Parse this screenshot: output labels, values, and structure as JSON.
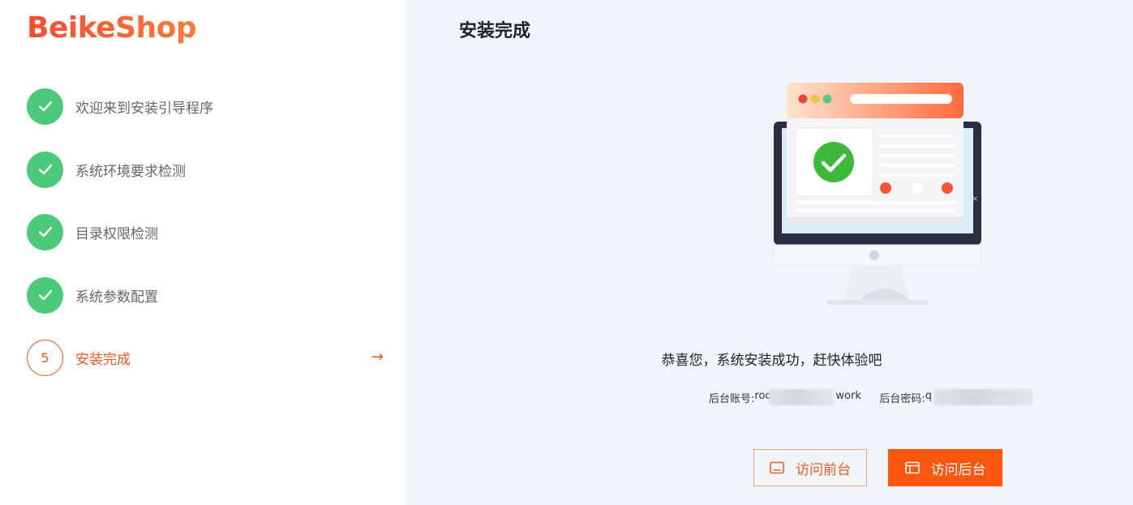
{
  "brand": {
    "logo_text": "BeikeShop",
    "accent_color": "#f05a22",
    "success_color": "#4cc97a"
  },
  "sidebar": {
    "steps": [
      {
        "label": "欢迎来到安装引导程序",
        "status": "done",
        "icon": "check-icon"
      },
      {
        "label": "系统环境要求检测",
        "status": "done",
        "icon": "check-icon"
      },
      {
        "label": "目录权限检测",
        "status": "done",
        "icon": "check-icon"
      },
      {
        "label": "系统参数配置",
        "status": "done",
        "icon": "check-icon"
      },
      {
        "label": "安装完成",
        "status": "current",
        "number": "5",
        "arrow": "→"
      }
    ]
  },
  "main": {
    "title": "安装完成",
    "success_message": "恭喜您，系统安装成功，赶快体验吧",
    "credentials": {
      "account_label": "后台账号: ",
      "account_prefix": "root",
      "account_suffix": "work",
      "password_label": "后台密码: ",
      "password_prefix": "q"
    },
    "buttons": {
      "front_label": "访问前台",
      "back_label": "访问后台"
    }
  }
}
